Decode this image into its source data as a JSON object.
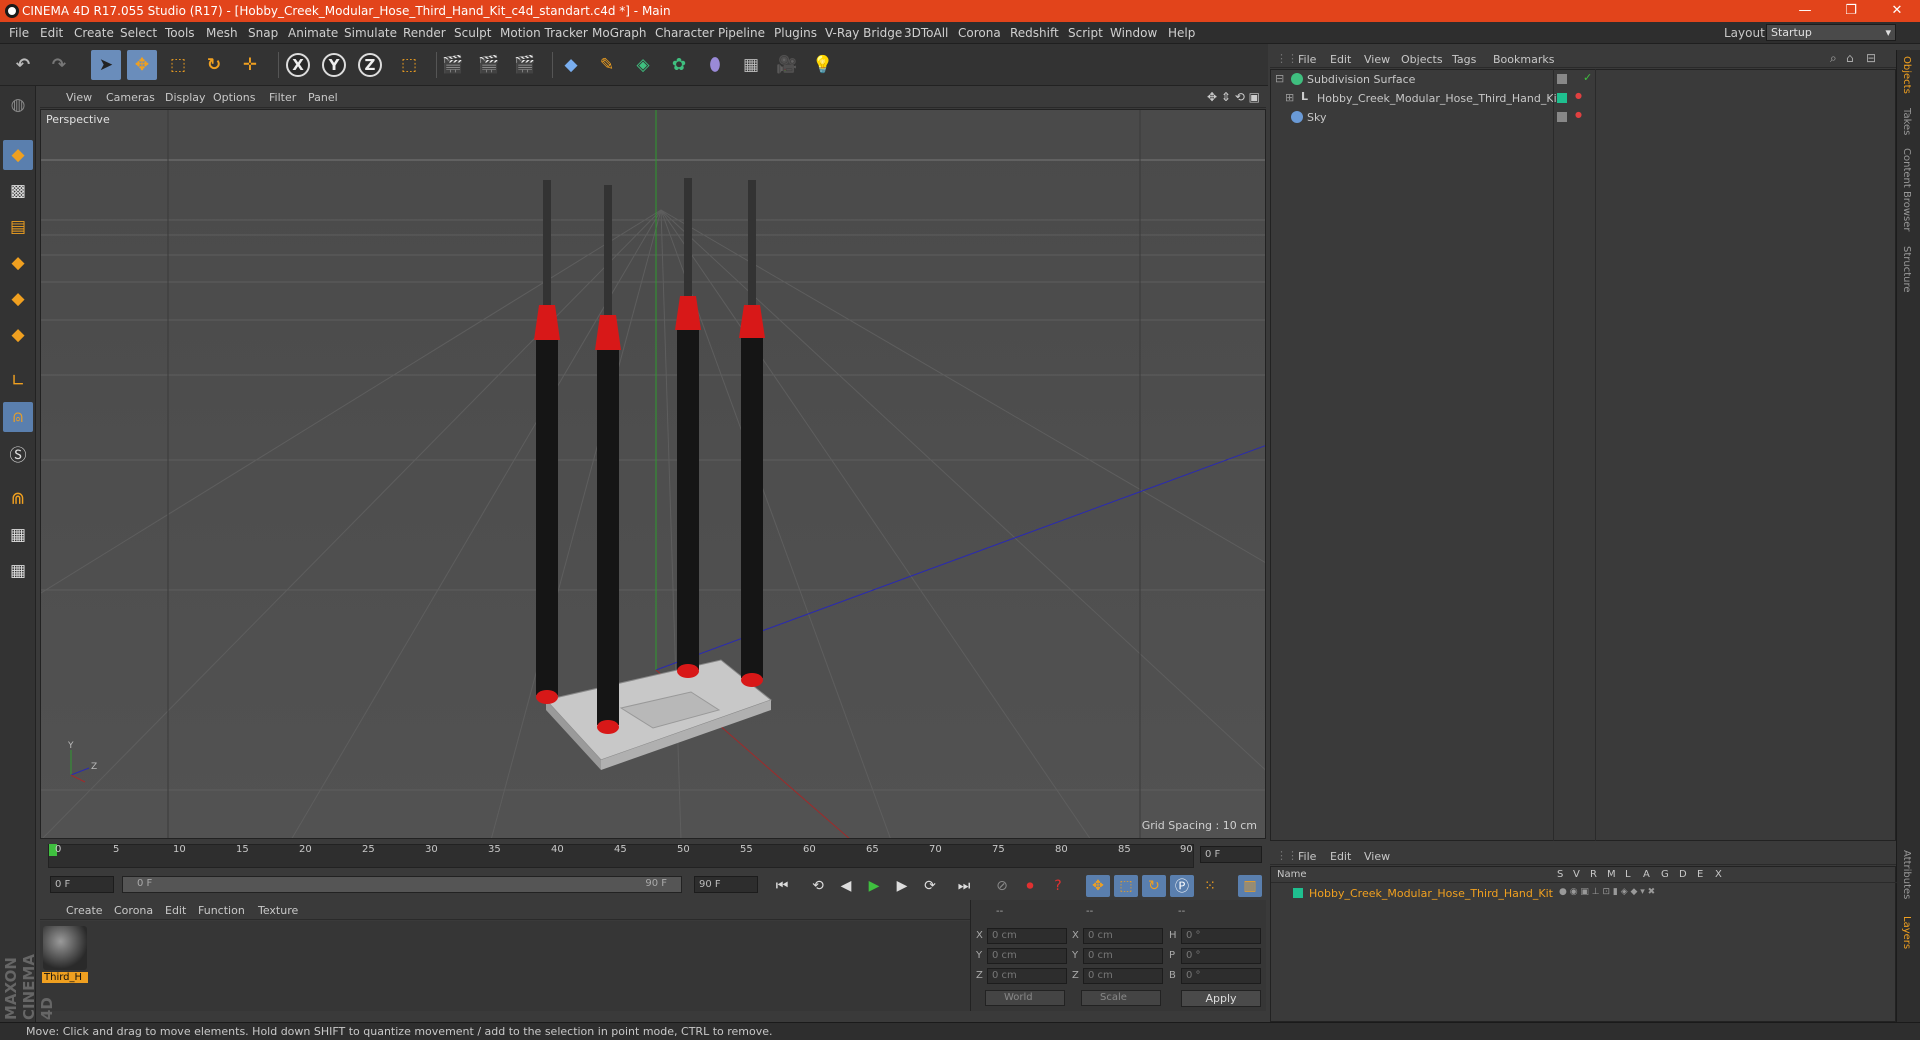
{
  "window": {
    "title": "CINEMA 4D R17.055 Studio (R17) - [Hobby_Creek_Modular_Hose_Third_Hand_Kit_c4d_standart.c4d *] - Main",
    "minimize": "—",
    "maximize": "❐",
    "close": "✕"
  },
  "menubar": {
    "items": [
      "File",
      "Edit",
      "Create",
      "Select",
      "Tools",
      "Mesh",
      "Snap",
      "Animate",
      "Simulate",
      "Render",
      "Sculpt",
      "Motion Tracker",
      "MoGraph",
      "Character",
      "Pipeline",
      "Plugins",
      "V-Ray Bridge",
      "3DToAll",
      "Corona",
      "Redshift",
      "Script",
      "Window",
      "Help"
    ],
    "layout_label": "Layout:",
    "layout_value": "Startup"
  },
  "toolbar": {
    "undo": "↶",
    "redo": "↷",
    "select": "➤",
    "move": "✥",
    "scale": "⬚",
    "rotate": "↻",
    "move2": "✛",
    "x": "X",
    "y": "Y",
    "z": "Z",
    "coord": "⬚"
  },
  "viewport": {
    "menus": [
      "View",
      "Cameras",
      "Display",
      "Options",
      "Filter",
      "Panel"
    ],
    "label": "Perspective",
    "grid_spacing": "Grid Spacing : 10 cm",
    "axis_y": "Y",
    "axis_z": "Z"
  },
  "timeline": {
    "ticks": [
      "0",
      "5",
      "10",
      "15",
      "20",
      "25",
      "30",
      "35",
      "40",
      "45",
      "50",
      "55",
      "60",
      "65",
      "70",
      "75",
      "80",
      "85",
      "90"
    ],
    "current_frame": "0 F",
    "start": "0 F",
    "range_start": "0 F",
    "range_end": "90 F",
    "end": "90 F"
  },
  "materials": {
    "menus": [
      "Create",
      "Corona",
      "Edit",
      "Function",
      "Texture"
    ],
    "items": [
      {
        "name": "Third_H"
      }
    ]
  },
  "coordinates": {
    "header": [
      "--",
      "--",
      "--"
    ],
    "rows": [
      {
        "a": "X",
        "av": "0 cm",
        "b": "X",
        "bv": "0 cm",
        "c": "H",
        "cv": "0 °"
      },
      {
        "a": "Y",
        "av": "0 cm",
        "b": "Y",
        "bv": "0 cm",
        "c": "P",
        "cv": "0 °"
      },
      {
        "a": "Z",
        "av": "0 cm",
        "b": "Z",
        "bv": "0 cm",
        "c": "B",
        "cv": "0 °"
      }
    ],
    "mode": "World",
    "size_mode": "Scale",
    "apply": "Apply"
  },
  "objects": {
    "menus": [
      "File",
      "Edit",
      "View",
      "Objects",
      "Tags",
      "Bookmarks"
    ],
    "tree": [
      {
        "name": "Subdivision Surface",
        "icon": "subdivision-icon",
        "color": "#3fbf7f"
      },
      {
        "name": "Hobby_Creek_Modular_Hose_Third_Hand_Kit",
        "icon": "null-object-icon",
        "color": "#cccccc"
      },
      {
        "name": "Sky",
        "icon": "sky-icon",
        "color": "#6a9ad6"
      }
    ]
  },
  "layers": {
    "menus": [
      "File",
      "Edit",
      "View"
    ],
    "columns": [
      "Name",
      "S",
      "V",
      "R",
      "M",
      "L",
      "A",
      "G",
      "D",
      "E",
      "X"
    ],
    "rows": [
      {
        "name": "Hobby_Creek_Modular_Hose_Third_Hand_Kit",
        "color": "#1fbf8f"
      }
    ]
  },
  "right_tabs": [
    "Objects",
    "Takes",
    "Content Browser",
    "Structure",
    "Attributes",
    "Layers"
  ],
  "status": "Move: Click and drag to move elements. Hold down SHIFT to quantize movement / add to the selection in point mode, CTRL to remove.",
  "logo": "MAXON CINEMA 4D"
}
